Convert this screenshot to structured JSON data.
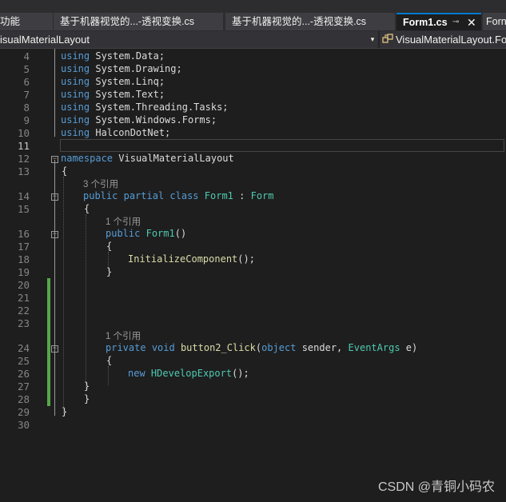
{
  "tabs": {
    "partial": "功能",
    "tab1": "基于机器视觉的...-透视变换.cs",
    "tab2": "基于机器视觉的...-透视变换.cs",
    "active": "Form1.cs",
    "active_pin": "⊸",
    "active_close": "✕",
    "next": "Forn"
  },
  "nav": {
    "project": "isualMaterialLayout",
    "dropdown": "▾",
    "member": "VisualMaterialLayout.For"
  },
  "lines": {
    "n4": "4",
    "n5": "5",
    "n6": "6",
    "n7": "7",
    "n8": "8",
    "n9": "9",
    "n10": "10",
    "n11": "11",
    "n12": "12",
    "n13": "13",
    "n14": "14",
    "n15": "15",
    "n16": "16",
    "n17": "17",
    "n18": "18",
    "n19": "19",
    "n20": "20",
    "n21": "21",
    "n22": "22",
    "n23": "23",
    "n24": "24",
    "n25": "25",
    "n26": "26",
    "n27": "27",
    "n28": "28",
    "n29": "29",
    "n30": "30"
  },
  "code": {
    "using": "using",
    "ns_data": "System.Data;",
    "ns_drawing": "System.Drawing;",
    "ns_linq": "System.Linq;",
    "ns_text": "System.Text;",
    "ns_tasks": "System.Threading.Tasks;",
    "ns_forms": "System.Windows.Forms;",
    "ns_halcon": "HalconDotNet;",
    "namespace_kw": "namespace",
    "namespace_name": "VisualMaterialLayout",
    "open_brace": "{",
    "close_brace": "}",
    "ref_class": "3 个引用",
    "public": "public",
    "partial": "partial",
    "class": "class",
    "class_name": "Form1",
    "colon": ":",
    "base_type": "Form",
    "ref_ctor": "1 个引用",
    "ctor_name": "Form1",
    "parens": "()",
    "init_call": "InitializeComponent",
    "init_tail": "();",
    "ref_method": "1 个引用",
    "private": "private",
    "void": "void",
    "method_name": "button2_Click",
    "paren_open": "(",
    "object": "object",
    "sender": "sender,",
    "event_args": "EventArgs",
    "e_param": "e)",
    "new": "new",
    "hdev": "HDevelopExport",
    "hdev_tail": "();"
  },
  "fold_minus": "−",
  "watermark": "CSDN @青铜小码农"
}
